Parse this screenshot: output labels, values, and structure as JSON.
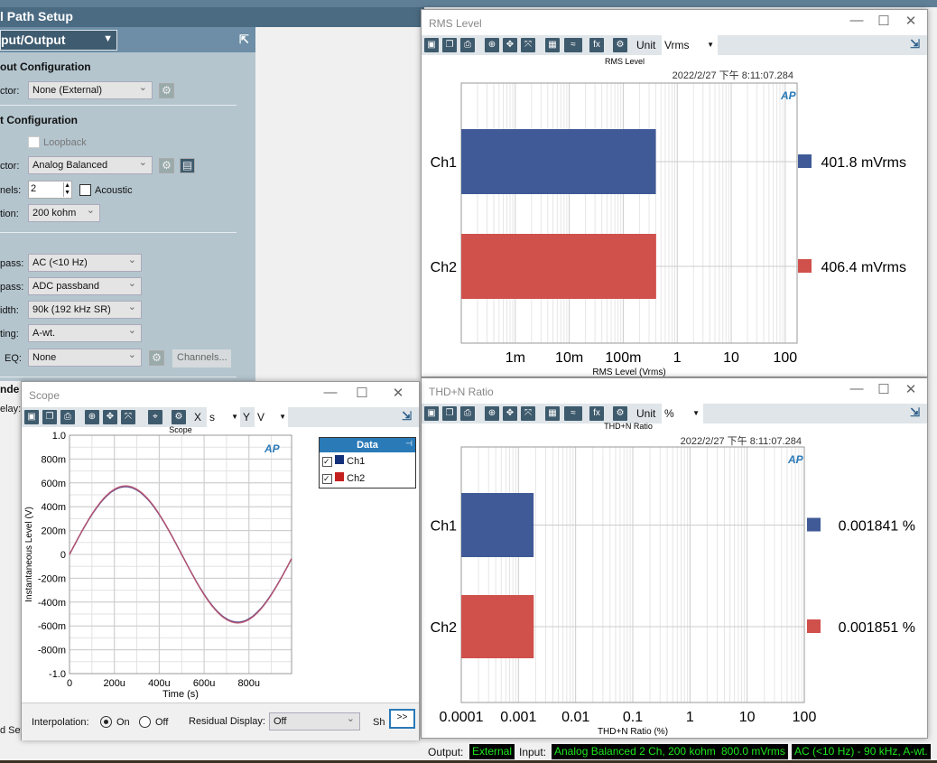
{
  "app": {
    "panel_title": "l Path Setup",
    "section_select": "put/Output"
  },
  "output_config": {
    "title": "out Configuration",
    "connector_label": "ctor:",
    "connector_value": "None (External)"
  },
  "input_config": {
    "title": "t Configuration",
    "loopback_label": "Loopback",
    "loopback_checked": false,
    "connector_label": "ctor:",
    "connector_value": "Analog Balanced",
    "channels_label": "nels:",
    "channels_value": "2",
    "acoustic_label": "Acoustic",
    "acoustic_checked": false,
    "termination_label": "tion:",
    "termination_value": "200 kohm"
  },
  "filters": [
    {
      "label": "pass:",
      "value": "AC (<10 Hz)"
    },
    {
      "label": "pass:",
      "value": "ADC passband"
    },
    {
      "label": "idth:",
      "value": "90k (192 kHz SR)"
    },
    {
      "label": "ting:",
      "value": "A-wt."
    },
    {
      "label": "EQ:",
      "value": "None"
    }
  ],
  "channels_button": "Channels...",
  "partial_labels": {
    "under": "nde",
    "delay": "elay:",
    "setup": "d Set"
  },
  "rms": {
    "window_title": "RMS Level",
    "unit_label": "Unit",
    "unit_value": "Vrms",
    "timestamp": "2022/2/27 下午 8:11:07.284",
    "legend_values": [
      "401.8  mVrms",
      "406.4  mVrms"
    ]
  },
  "thd": {
    "window_title": "THD+N Ratio",
    "unit_label": "Unit",
    "unit_value": "%",
    "timestamp": "2022/2/27 下午 8:11:07.284",
    "legend_values": [
      "0.001841 %",
      "0.001851 %"
    ]
  },
  "scope": {
    "window_title": "Scope",
    "x_label": "X",
    "x_unit": "s",
    "y_label": "Y",
    "y_unit": "V",
    "data_panel_title": "Data",
    "channels": [
      {
        "name": "Ch1",
        "checked": true
      },
      {
        "name": "Ch2",
        "checked": true
      }
    ],
    "interpolation_label": "Interpolation:",
    "interp_on": "On",
    "interp_off": "Off",
    "interp_selected": "On",
    "residual_label": "Residual Display:",
    "residual_value": "Off",
    "show_label": "Sh",
    "more_button": ">>"
  },
  "status": {
    "output_label": "Output:",
    "output_value": "External",
    "input_label": "Input:",
    "input_value": "Analog Balanced 2 Ch, 200 kohm",
    "level": "800.0 mVrms",
    "filter": "AC (<10 Hz) - 90 kHz, A-wt."
  },
  "colors": {
    "ch1": "#3f5a97",
    "ch2": "#d0504c",
    "accent": "#2a7ab8"
  },
  "chart_data": [
    {
      "type": "bar",
      "orientation": "horizontal",
      "title": "RMS Level",
      "xlabel": "RMS Level (Vrms)",
      "xscale": "log",
      "xlim": [
        0.0001,
        166
      ],
      "categories": [
        "Ch1",
        "Ch2"
      ],
      "values": [
        0.4018,
        0.4064
      ],
      "xticks": [
        {
          "v": 0.001,
          "label": "1m"
        },
        {
          "v": 0.01,
          "label": "10m"
        },
        {
          "v": 0.1,
          "label": "100m"
        },
        {
          "v": 1,
          "label": "1"
        },
        {
          "v": 10,
          "label": "10"
        },
        {
          "v": 100,
          "label": "100"
        }
      ],
      "grid": true
    },
    {
      "type": "bar",
      "orientation": "horizontal",
      "title": "THD+N Ratio",
      "xlabel": "THD+N Ratio (%)",
      "xscale": "log",
      "xlim": [
        0.0001,
        100
      ],
      "categories": [
        "Ch1",
        "Ch2"
      ],
      "values": [
        0.001841,
        0.001851
      ],
      "xticks": [
        {
          "v": 0.0001,
          "label": "0.0001"
        },
        {
          "v": 0.001,
          "label": "0.001"
        },
        {
          "v": 0.01,
          "label": "0.01"
        },
        {
          "v": 0.1,
          "label": "0.1"
        },
        {
          "v": 1,
          "label": "1"
        },
        {
          "v": 10,
          "label": "10"
        },
        {
          "v": 100,
          "label": "100"
        }
      ],
      "grid": true
    },
    {
      "type": "line",
      "title": "Scope",
      "xlabel": "Time (s)",
      "ylabel": "Instantaneous Level (V)",
      "xlim": [
        0,
        0.00099
      ],
      "ylim": [
        -1,
        1
      ],
      "xticks": [
        {
          "v": 0,
          "label": "0"
        },
        {
          "v": 0.0002,
          "label": "200u"
        },
        {
          "v": 0.0004,
          "label": "400u"
        },
        {
          "v": 0.0006,
          "label": "600u"
        },
        {
          "v": 0.0008,
          "label": "800u"
        }
      ],
      "yticks": [
        {
          "v": 1,
          "label": "1.0"
        },
        {
          "v": 0.8,
          "label": "800m"
        },
        {
          "v": 0.6,
          "label": "600m"
        },
        {
          "v": 0.4,
          "label": "400m"
        },
        {
          "v": 0.2,
          "label": "200m"
        },
        {
          "v": 0,
          "label": "0"
        },
        {
          "v": -0.2,
          "label": "-200m"
        },
        {
          "v": -0.4,
          "label": "-400m"
        },
        {
          "v": -0.6,
          "label": "-600m"
        },
        {
          "v": -0.8,
          "label": "-800m"
        },
        {
          "v": -1,
          "label": "-1.0"
        }
      ],
      "series": [
        {
          "name": "Ch1",
          "waveform": "sine",
          "frequency_hz": 1000,
          "amplitude": 0.568
        },
        {
          "name": "Ch2",
          "waveform": "sine",
          "frequency_hz": 1000,
          "amplitude": 0.575
        }
      ],
      "grid": true
    }
  ]
}
